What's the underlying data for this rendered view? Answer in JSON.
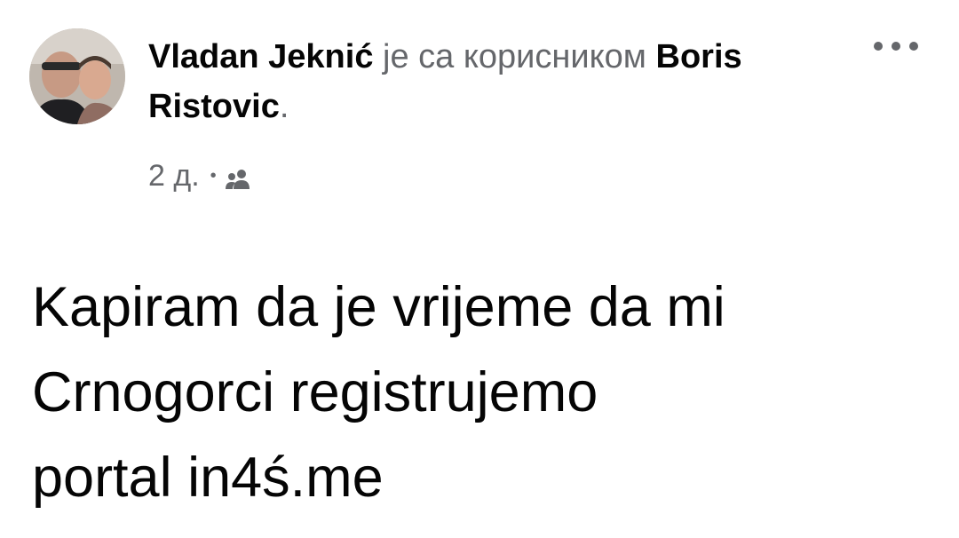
{
  "post": {
    "author": "Vladan Jeknić",
    "with_text": "је са корисником",
    "tagged_user": "Boris Ristovic",
    "period": ".",
    "time": "2 д.",
    "separator": "•",
    "audience_icon": "friends-icon",
    "body_line1": "Kapiram da je vrijeme da mi",
    "body_line2": "Crnogorci registrujemo",
    "body_line3": "portal in4ś.me"
  },
  "colors": {
    "text_primary": "#050505",
    "text_secondary": "#65676b",
    "background": "#ffffff"
  }
}
